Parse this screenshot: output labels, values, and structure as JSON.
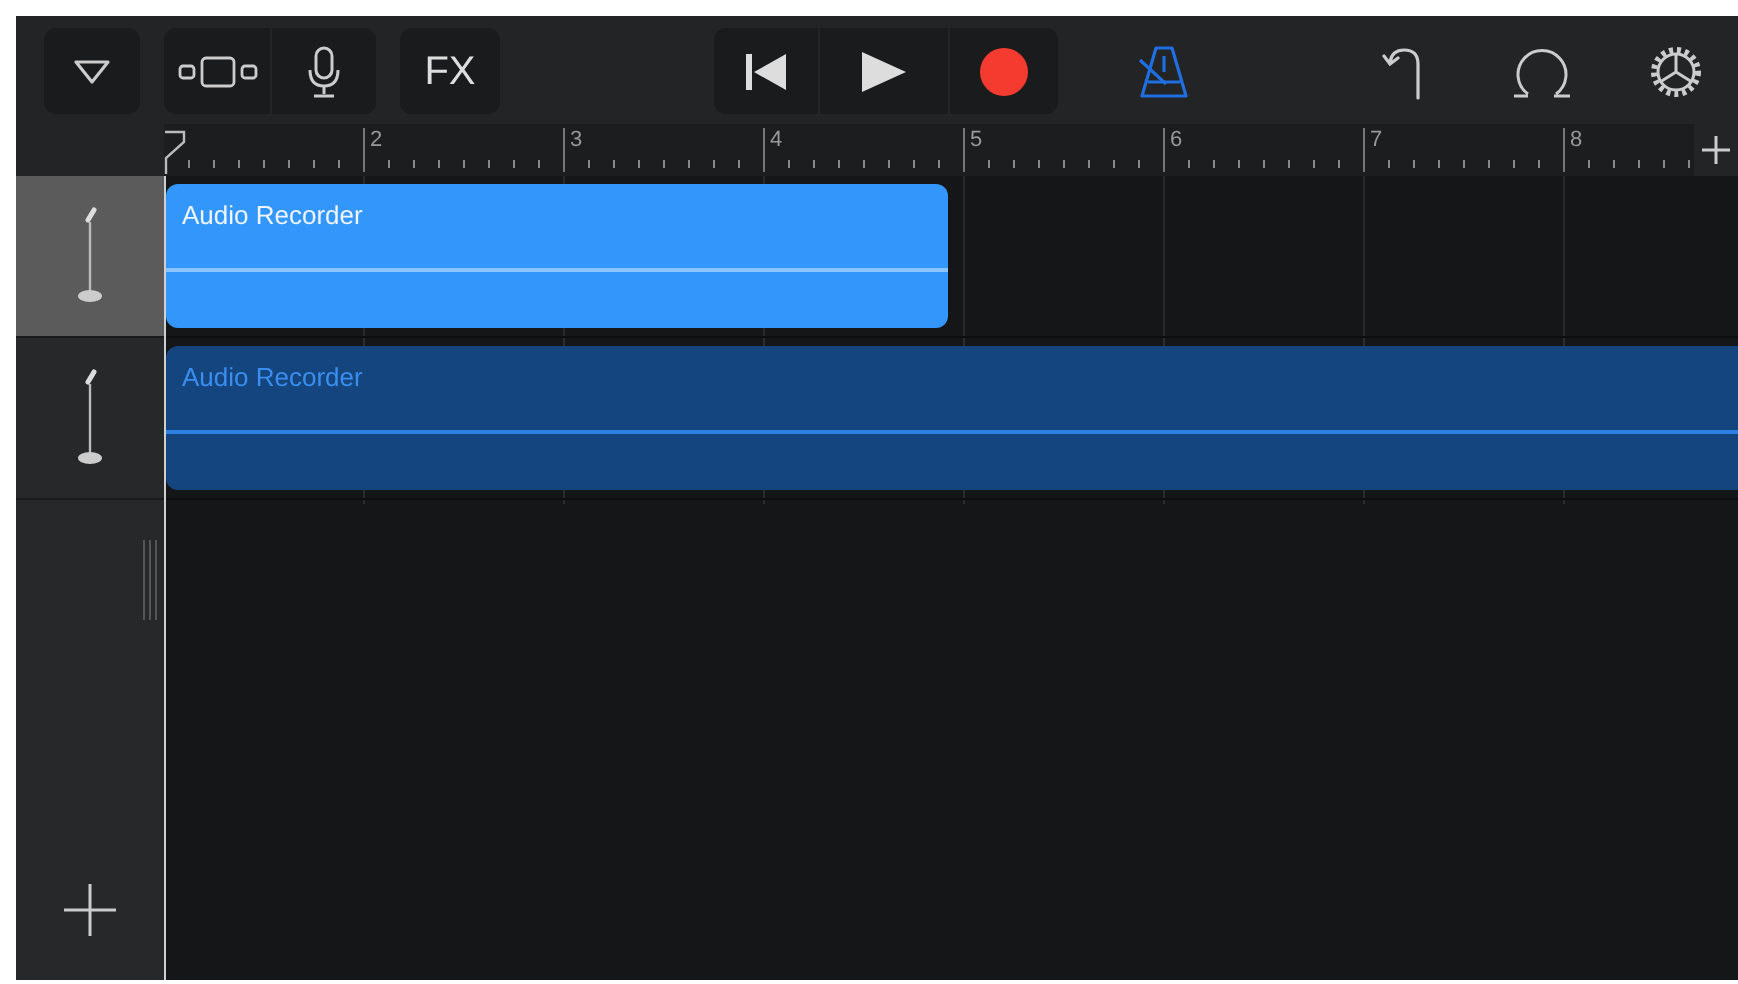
{
  "toolbar": {
    "fx_label": "FX",
    "metronome": {
      "on": true
    }
  },
  "ruler": {
    "bars": [
      "2",
      "3",
      "4",
      "5",
      "6",
      "7",
      "8"
    ]
  },
  "tracks": [
    {
      "selected": true,
      "region": {
        "label": "Audio Recorder",
        "selected": true
      }
    },
    {
      "selected": false,
      "region": {
        "label": "Audio Recorder",
        "selected": false
      }
    }
  ]
}
